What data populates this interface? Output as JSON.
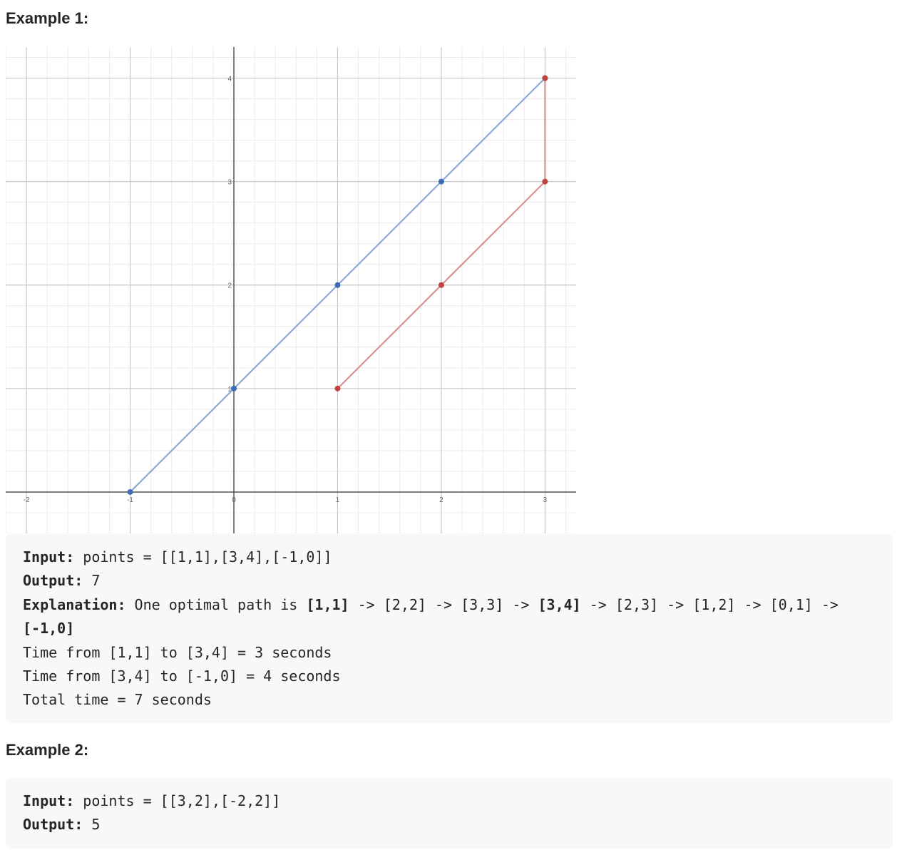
{
  "example1": {
    "heading": "Example 1:",
    "input_label": "Input:",
    "input_value": " points = [[1,1],[3,4],[-1,0]]",
    "output_label": "Output:",
    "output_value": " 7",
    "explanation_label": "Explanation:",
    "explanation_pre": " One optimal path is ",
    "explanation_b1": "[1,1]",
    "explanation_mid": " -> [2,2] -> [3,3] -> ",
    "explanation_b2": "[3,4]",
    "explanation_post": " -> [2,3] -> [1,2] -> [0,1] ->",
    "explanation_b3": "[-1,0]",
    "line_time1": "Time from [1,1] to [3,4] = 3 seconds",
    "line_time2": "Time from [3,4] to [-1,0] = 4 seconds",
    "line_total": "Total time = 7 seconds"
  },
  "example2": {
    "heading": "Example 2:",
    "input_label": "Input:",
    "input_value": " points = [[3,2],[-2,2]]",
    "output_label": "Output:",
    "output_value": " 5"
  },
  "chart_data": {
    "type": "line",
    "title": "",
    "xlabel": "",
    "ylabel": "",
    "xlim": [
      -2.2,
      3.3
    ],
    "ylim": [
      -0.4,
      4.3
    ],
    "x_ticks": [
      -2,
      -1,
      0,
      1,
      2,
      3
    ],
    "y_ticks": [
      1,
      2,
      3,
      4
    ],
    "grid": true,
    "series": [
      {
        "color": "#8daad6",
        "point_color": "#3d6eb5",
        "points": [
          [
            -1,
            0
          ],
          [
            0,
            1
          ],
          [
            1,
            2
          ],
          [
            2,
            3
          ],
          [
            3,
            4
          ]
        ]
      },
      {
        "color": "#d9908f",
        "point_color": "#c0433f",
        "points": [
          [
            1,
            1
          ],
          [
            2,
            2
          ],
          [
            3,
            3
          ],
          [
            3,
            4
          ]
        ]
      }
    ]
  }
}
